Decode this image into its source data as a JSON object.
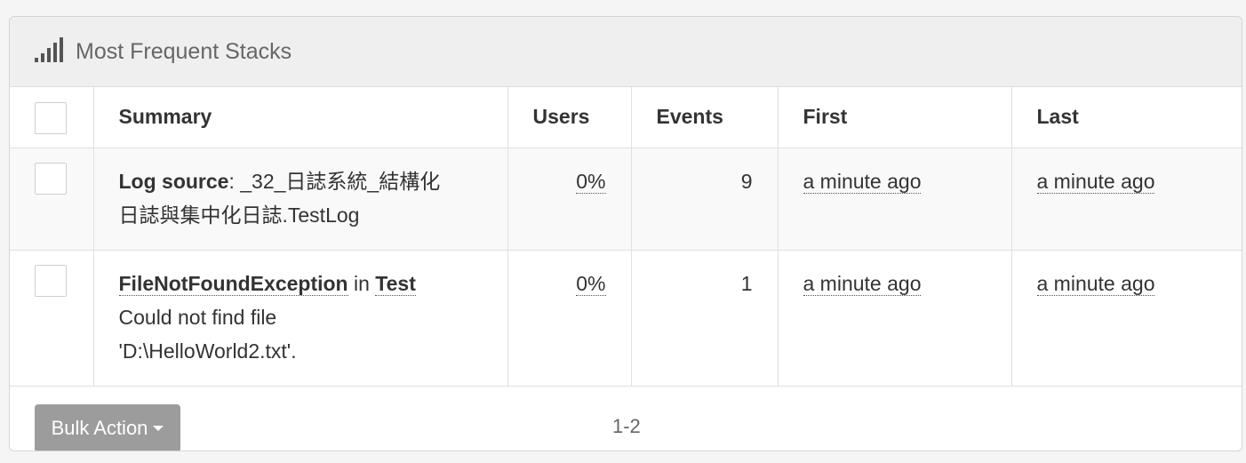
{
  "panel": {
    "title": "Most Frequent Stacks",
    "icon": "signal-icon"
  },
  "table": {
    "headers": {
      "summary": "Summary",
      "users": "Users",
      "events": "Events",
      "first": "First",
      "last": "Last"
    },
    "rows": [
      {
        "label": "Log source",
        "sep": ":",
        "value_line1": "_32_日誌系統_結構化",
        "value_line2": "日誌與集中化日誌.TestLog",
        "users": "0%",
        "events": "9",
        "first": "a minute ago",
        "last": "a minute ago"
      },
      {
        "exception": "FileNotFoundException",
        "in_word": "in",
        "method": "Test",
        "message_line1": "Could not find file",
        "message_line2": "'D:\\HelloWorld2.txt'.",
        "users": "0%",
        "events": "1",
        "first": "a minute ago",
        "last": "a minute ago"
      }
    ]
  },
  "footer": {
    "bulk_action": "Bulk Action",
    "pagination": "1-2"
  }
}
